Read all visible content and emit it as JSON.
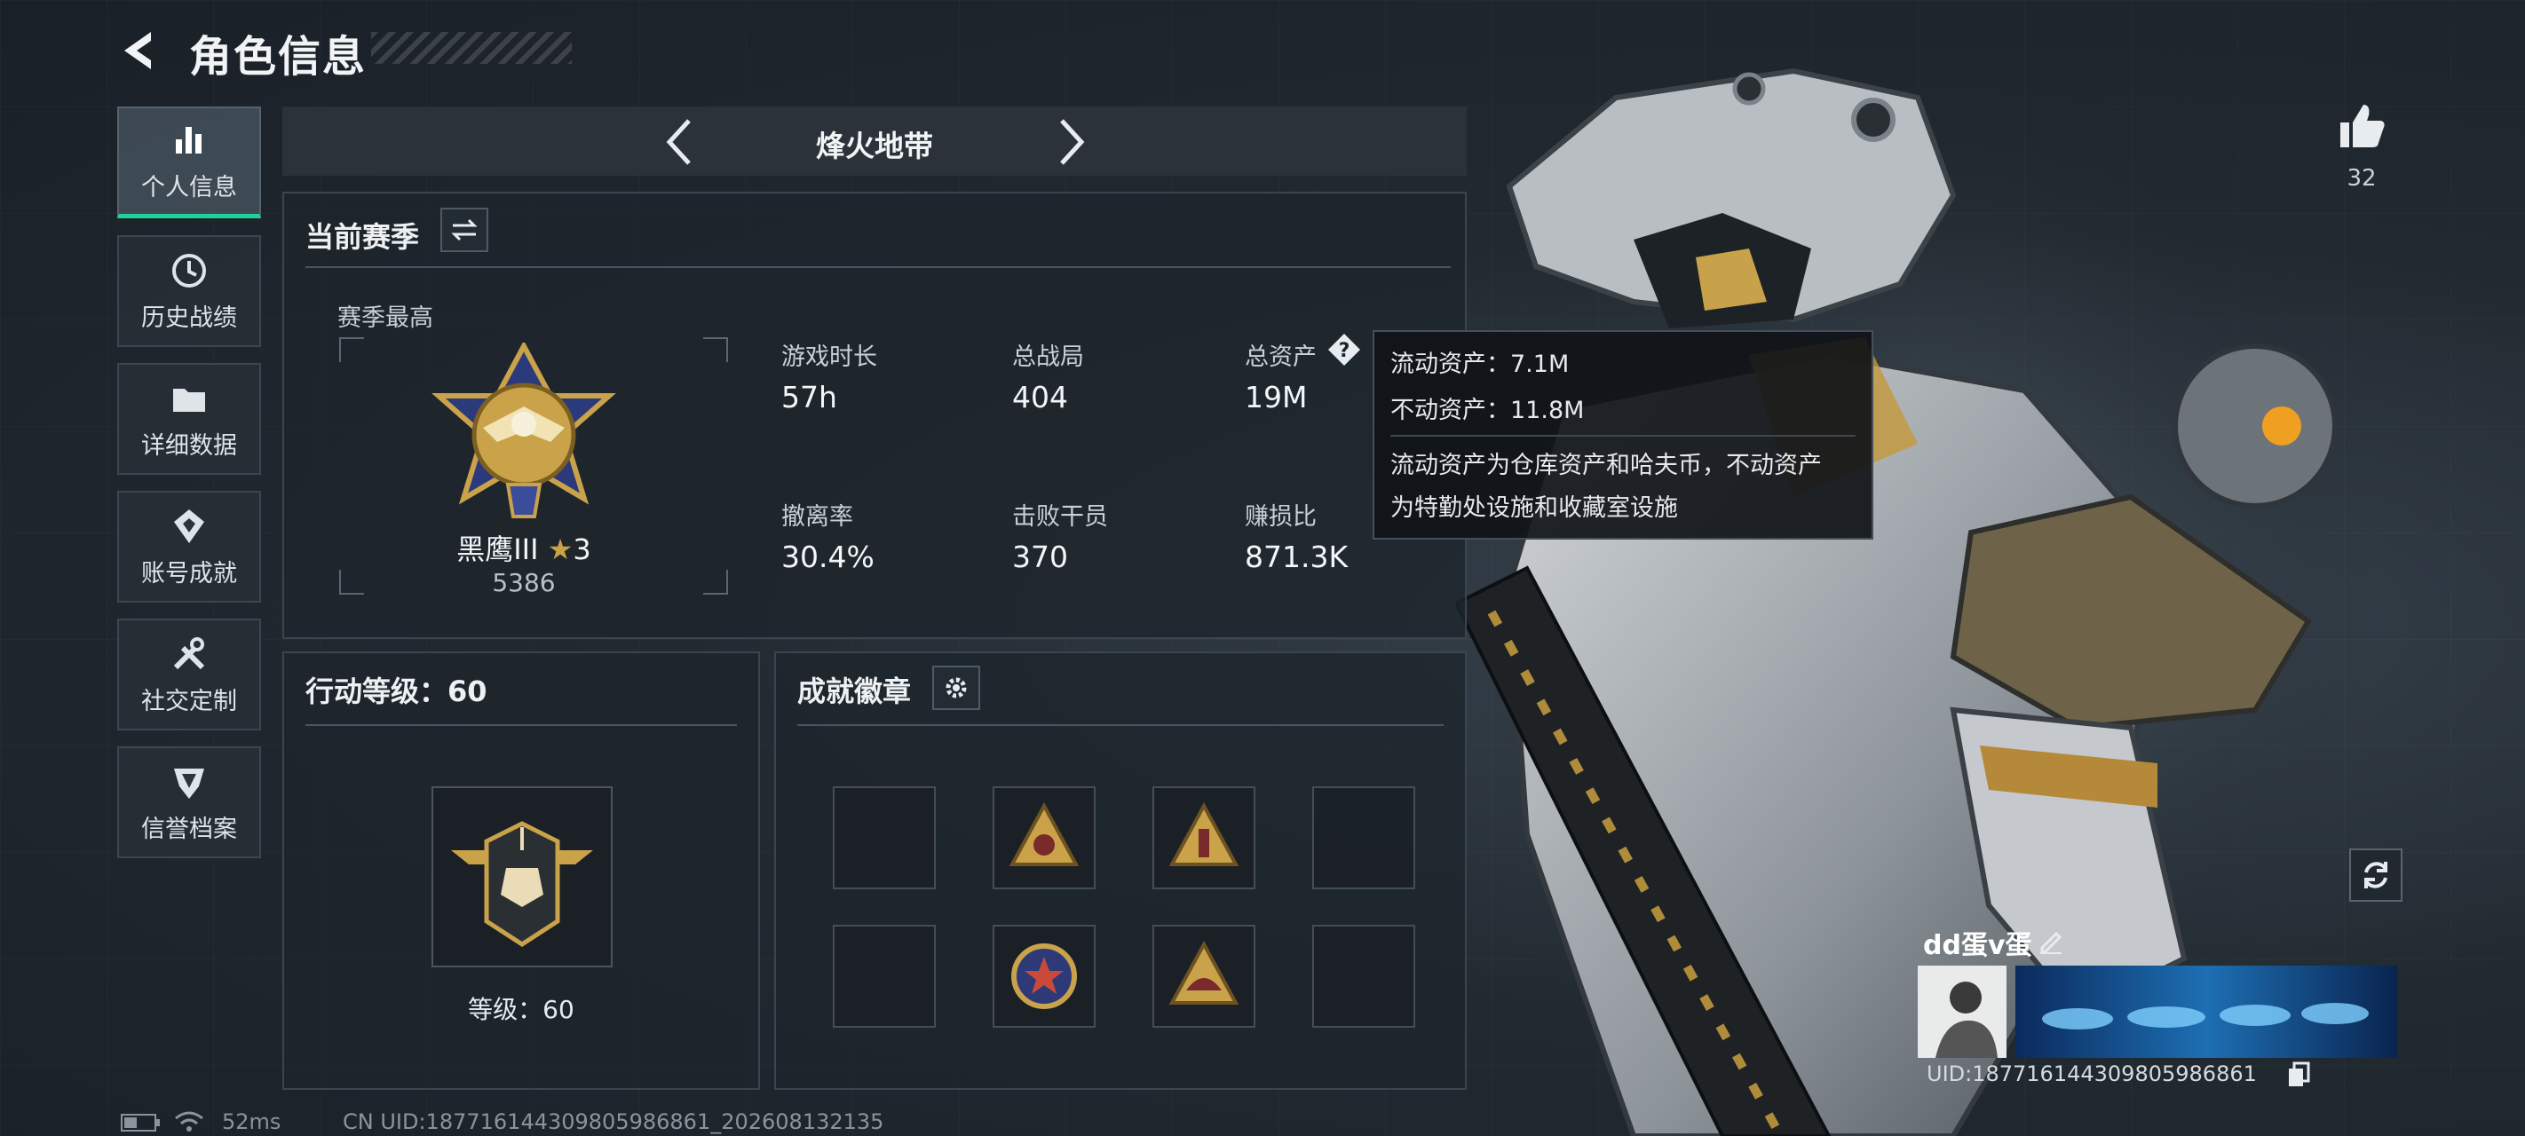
{
  "header": {
    "title": "角色信息"
  },
  "nav": [
    {
      "label": "个人信息",
      "icon": "bar-chart-icon",
      "active": true
    },
    {
      "label": "历史战绩",
      "icon": "clock-icon"
    },
    {
      "label": "详细数据",
      "icon": "folder-icon"
    },
    {
      "label": "账号成就",
      "icon": "achievement-icon"
    },
    {
      "label": "社交定制",
      "icon": "wrench-icon"
    },
    {
      "label": "信誉档案",
      "icon": "shield-icon"
    }
  ],
  "season_bar": {
    "name": "烽火地带"
  },
  "current_season": {
    "title": "当前赛季",
    "best_label": "赛季最高",
    "rank_name": "黑鹰III",
    "rank_stars": "3",
    "rank_score": "5386",
    "stats": [
      {
        "label": "游戏时长",
        "value": "57h"
      },
      {
        "label": "总战局",
        "value": "404"
      },
      {
        "label": "总资产",
        "value": "19M"
      },
      {
        "label": "撤离率",
        "value": "30.4%"
      },
      {
        "label": "击败干员",
        "value": "370"
      },
      {
        "label": "赚损比",
        "value": "871.3K"
      }
    ]
  },
  "tooltip": {
    "line1": "流动资产：7.1M",
    "line2": "不动资产：11.8M",
    "desc1": "流动资产为仓库资产和哈夫币，不动资产",
    "desc2": "为特勤处设施和收藏室设施"
  },
  "action_level": {
    "title": "行动等级：60",
    "level_text": "等级：60"
  },
  "badges": {
    "title": "成就徽章"
  },
  "likes": {
    "count": "32"
  },
  "profile": {
    "name": "dd蛋v蛋",
    "uid_short": "UID:1877161443098059​86861"
  },
  "status_bar": {
    "ping": "52ms",
    "uid_full": "CN UID:1877161443098059​86861_202608132135"
  },
  "colors": {
    "accent": "#1fd19a",
    "gold": "#c9a24a"
  }
}
